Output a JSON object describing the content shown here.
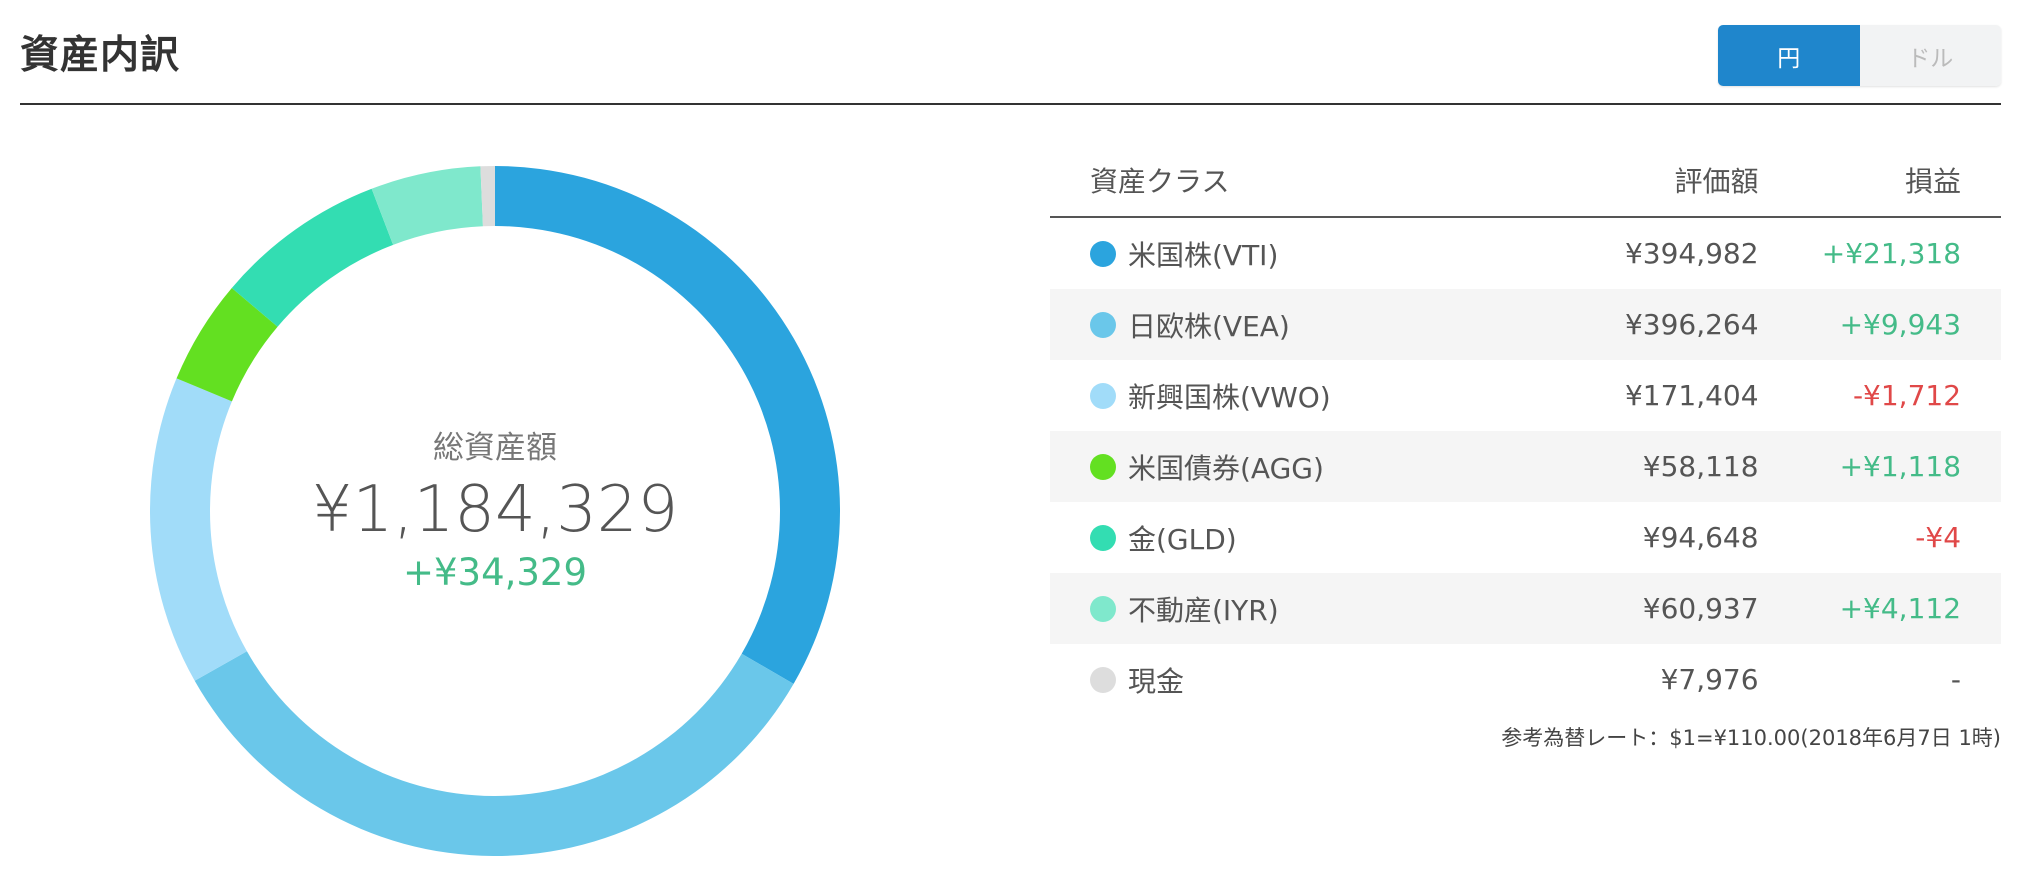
{
  "header": {
    "title": "資産内訳"
  },
  "currency_toggle": {
    "yen_label": "円",
    "dollar_label": "ドル",
    "selected": "円"
  },
  "summary": {
    "label": "総資産額",
    "total": "¥1,184,329",
    "change": "+¥34,329"
  },
  "table": {
    "headers": {
      "asset_class": "資産クラス",
      "value": "評価額",
      "gain": "損益"
    },
    "rows": [
      {
        "name": "米国株(VTI)",
        "value": "¥394,982",
        "gain": "+¥21,318",
        "gain_sign": "pos",
        "color": "#2ba4de"
      },
      {
        "name": "日欧株(VEA)",
        "value": "¥396,264",
        "gain": "+¥9,943",
        "gain_sign": "pos",
        "color": "#6ac7ea"
      },
      {
        "name": "新興国株(VWO)",
        "value": "¥171,404",
        "gain": "-¥1,712",
        "gain_sign": "neg",
        "color": "#a1dcf9"
      },
      {
        "name": "米国債券(AGG)",
        "value": "¥58,118",
        "gain": "+¥1,118",
        "gain_sign": "pos",
        "color": "#63e021"
      },
      {
        "name": "金(GLD)",
        "value": "¥94,648",
        "gain": "-¥4",
        "gain_sign": "neg",
        "color": "#33ddb2"
      },
      {
        "name": "不動産(IYR)",
        "value": "¥60,937",
        "gain": "+¥4,112",
        "gain_sign": "pos",
        "color": "#7fe8cc"
      },
      {
        "name": "現金",
        "value": "¥7,976",
        "gain": "-",
        "gain_sign": "neu",
        "color": "#dddddd"
      }
    ]
  },
  "rate_note": "参考為替レート：$1=¥110.00(2018年6月7日 1時)",
  "chart_data": {
    "type": "pie",
    "categories": [
      "米国株(VTI)",
      "日欧株(VEA)",
      "新興国株(VWO)",
      "米国債券(AGG)",
      "金(GLD)",
      "不動産(IYR)",
      "現金"
    ],
    "values": [
      394982,
      396264,
      171404,
      58118,
      94648,
      60937,
      7976
    ],
    "colors": [
      "#2ba4de",
      "#6ac7ea",
      "#a1dcf9",
      "#63e021",
      "#33ddb2",
      "#7fe8cc",
      "#dddddd"
    ],
    "title": "",
    "legend": "right"
  }
}
